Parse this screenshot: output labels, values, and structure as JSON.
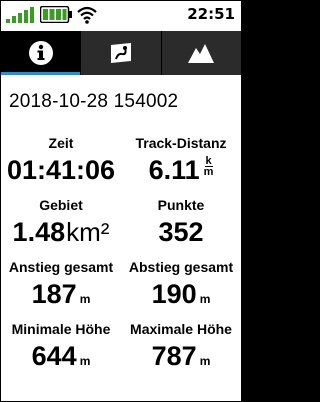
{
  "status": {
    "time": "22:51",
    "battery_color": "#3a9d23",
    "signal_color": "#3a9d23",
    "wifi_icon": "wifi-icon"
  },
  "tabs": [
    {
      "name": "info-icon",
      "active": true
    },
    {
      "name": "map-track-icon",
      "active": false
    },
    {
      "name": "elevation-profile-icon",
      "active": false
    }
  ],
  "track": {
    "title": "2018-10-28 154002",
    "stats": {
      "time_label": "Zeit",
      "time_value": "01:41:06",
      "distance_label": "Track-Distanz",
      "distance_value": "6.11",
      "distance_unit_top": "k",
      "distance_unit_bottom": "m",
      "area_label": "Gebiet",
      "area_value": "1.48",
      "area_unit": "km²",
      "points_label": "Punkte",
      "points_value": "352",
      "ascent_label": "Anstieg gesamt",
      "ascent_value": "187",
      "ascent_unit": "m",
      "descent_label": "Abstieg gesamt",
      "descent_value": "190",
      "descent_unit": "m",
      "min_elev_label": "Minimale Höhe",
      "min_elev_value": "644",
      "min_elev_unit": "m",
      "max_elev_label": "Maximale Höhe",
      "max_elev_value": "787",
      "max_elev_unit": "m"
    }
  }
}
